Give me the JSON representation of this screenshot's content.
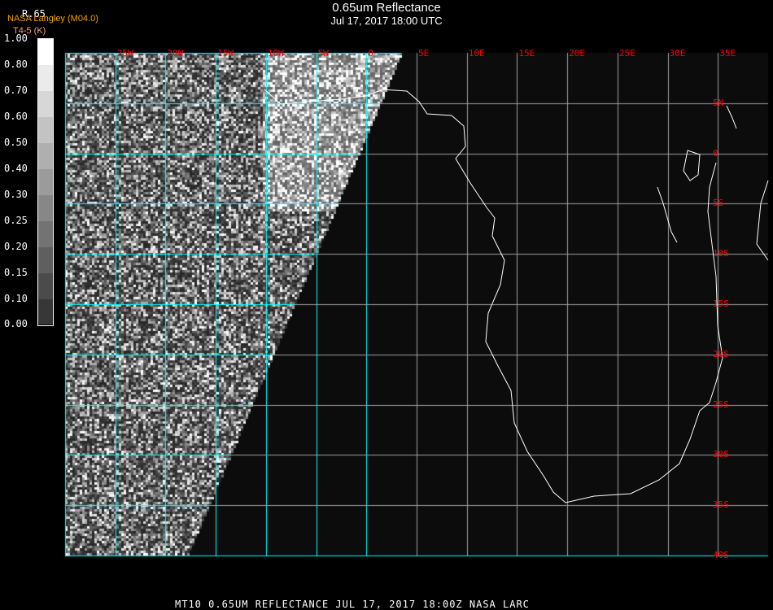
{
  "header": {
    "title": "0.65um Reflectance",
    "subtitle": "Jul 17, 2017 18:00 UTC",
    "credit": "NASA Langley (M04.0)",
    "band_label": "R.65",
    "unit_label": "T4-5 (K)",
    "unit_extra": "(-- )"
  },
  "colorbar": {
    "ticks": [
      "1.00",
      "0.80",
      "0.70",
      "0.60",
      "0.50",
      "0.40",
      "0.30",
      "0.25",
      "0.20",
      "0.15",
      "0.10",
      "0.00"
    ]
  },
  "map": {
    "lon_labels": [
      "25W",
      "20W",
      "15W",
      "10W",
      "5W",
      "0",
      "5E",
      "10E",
      "15E",
      "20E",
      "25E",
      "30E",
      "35E"
    ],
    "lat_labels": [
      "5N",
      "0",
      "5S",
      "10S",
      "15S",
      "20S",
      "25S",
      "30S",
      "35S",
      "40S"
    ],
    "grid_color": "#00ffff",
    "label_color": "#ff0000"
  },
  "footer": "MT10  0.65UM REFLECTANCE   JUL 17, 2017 18:00Z   NASA LARC"
}
